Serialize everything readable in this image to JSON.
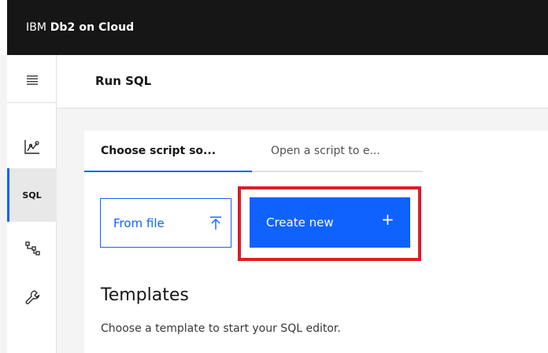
{
  "header": {
    "brand_ibm": "IBM",
    "brand_product": "Db2 on Cloud",
    "background": "#161616"
  },
  "rail": {
    "items": [
      {
        "name": "monitor",
        "icon": "line-chart-icon"
      },
      {
        "name": "sql",
        "label": "SQL",
        "selected": true
      },
      {
        "name": "schema",
        "icon": "hierarchy-icon"
      },
      {
        "name": "administration",
        "icon": "wrench-icon"
      }
    ]
  },
  "page": {
    "title": "Run SQL"
  },
  "tabs": [
    {
      "label": "Choose script so...",
      "selected": true
    },
    {
      "label": "Open a script to e..."
    }
  ],
  "buttons": {
    "from_file": "From file",
    "create_new": "Create new"
  },
  "templates": {
    "title": "Templates",
    "description": "Choose a template to start your SQL editor."
  },
  "colors": {
    "accent": "#0f62fe",
    "highlight": "#da1e28"
  }
}
